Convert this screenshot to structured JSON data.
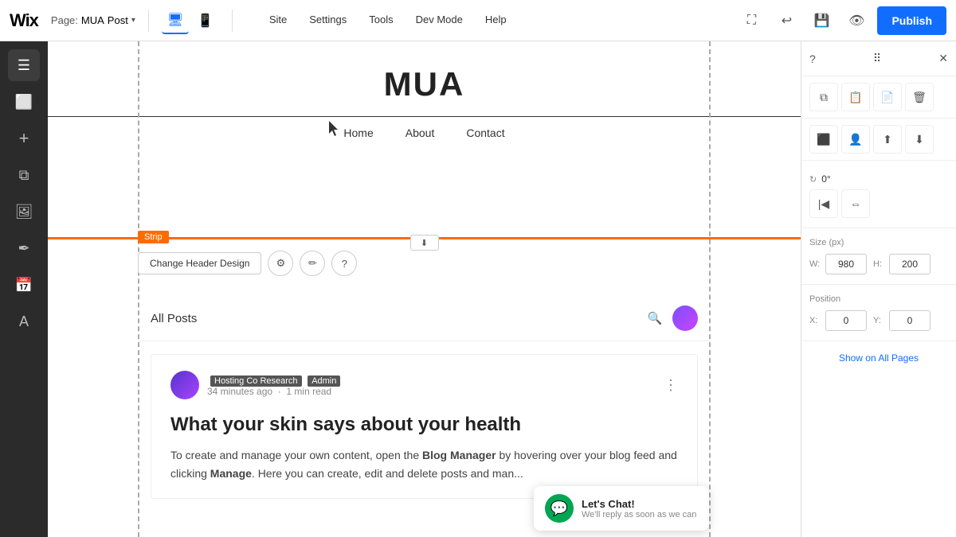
{
  "topbar": {
    "wix_logo": "Wix",
    "page_label": "Page:",
    "page_name": "Post",
    "desktop_icon": "🖥",
    "mobile_icon": "📱",
    "nav_site": "Site",
    "nav_settings": "Settings",
    "nav_tools": "Tools",
    "nav_devmode": "Dev Mode",
    "nav_help": "Help",
    "undo_icon": "↩",
    "save_icon": "💾",
    "preview_icon": "👁",
    "collapse_icon": "⛶",
    "publish_label": "Publish"
  },
  "left_sidebar": {
    "icons": [
      {
        "name": "pages-icon",
        "glyph": "☰",
        "active": true
      },
      {
        "name": "blocks-icon",
        "glyph": "⬜",
        "active": false
      },
      {
        "name": "add-icon",
        "glyph": "+",
        "active": false
      },
      {
        "name": "layers-icon",
        "glyph": "⧉",
        "active": false
      },
      {
        "name": "media-icon",
        "glyph": "🖼",
        "active": false
      },
      {
        "name": "design-icon",
        "glyph": "✒",
        "active": false
      },
      {
        "name": "calendar-icon",
        "glyph": "📅",
        "active": false
      },
      {
        "name": "apps-icon",
        "glyph": "A",
        "active": false
      }
    ]
  },
  "canvas": {
    "site_title": "MUA",
    "nav_items": [
      "Home",
      "About",
      "Contact"
    ],
    "strip_label": "Strip",
    "change_header_btn": "Change Header Design",
    "all_posts_label": "All Posts",
    "post": {
      "author": "Hosting Co Research",
      "author_badge": "Admin",
      "time_ago": "34 minutes ago",
      "read_time": "1 min read",
      "title": "What your skin says about your health",
      "content_start": "To create and manage your own content, open the ",
      "blog_manager": "Blog Manager",
      "content_mid": " by hovering over your blog feed and clicking ",
      "manage": "Manage",
      "content_end": ". Here you can create, edit and delete posts and man..."
    }
  },
  "right_panel": {
    "size_section": "Size (px)",
    "width_label": "W:",
    "width_value": "980",
    "height_label": "H:",
    "height_value": "200",
    "position_section": "Position",
    "x_label": "X:",
    "x_value": "0",
    "y_label": "Y:",
    "y_value": "0",
    "rotate_label": "0°",
    "show_all_pages": "Show on All Pages"
  },
  "chat": {
    "title": "Let's Chat!",
    "subtitle": "We'll reply as soon as we can"
  }
}
